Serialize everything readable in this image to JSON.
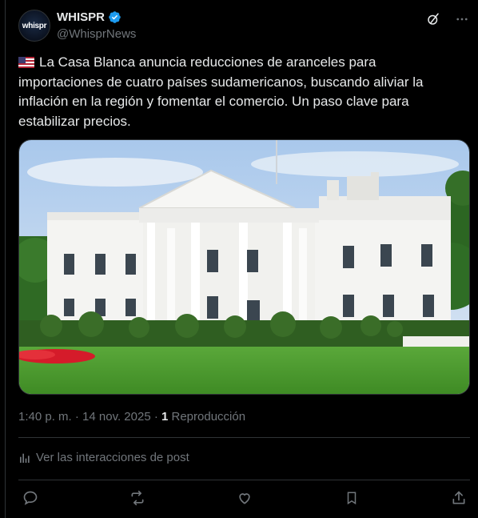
{
  "author": {
    "display_name": "WHISPR",
    "handle": "@WhisprNews",
    "avatar_text": "whispr",
    "verified_icon": "verified-badge-icon",
    "verified_color": "#1d9bf0"
  },
  "header_actions": [
    {
      "icon": "grok-icon"
    },
    {
      "icon": "more-icon"
    }
  ],
  "post": {
    "flag_icon": "us-flag-icon",
    "text": "La Casa Blanca anuncia reducciones de aranceles para importaciones de cuatro países sudamericanos, buscando aliviar la inflación en la región y fomentar el comercio. Un paso clave para estabilizar precios.",
    "image": "photo of the White House with green lawn and red flowers"
  },
  "meta": {
    "timestamp": "1:40 p. m. · 14 nov. 2025 · ",
    "views_count": "1",
    "views_label": " Reproducción"
  },
  "interactions_link": "Ver las interacciones de post",
  "actions": [
    {
      "icon": "reply-icon"
    },
    {
      "icon": "repost-icon"
    },
    {
      "icon": "like-icon"
    },
    {
      "icon": "bookmark-icon"
    },
    {
      "icon": "share-icon"
    }
  ],
  "colors": {
    "background": "#000000",
    "text": "#e7e9ea",
    "secondary": "#71767b",
    "border": "#2f3336"
  }
}
